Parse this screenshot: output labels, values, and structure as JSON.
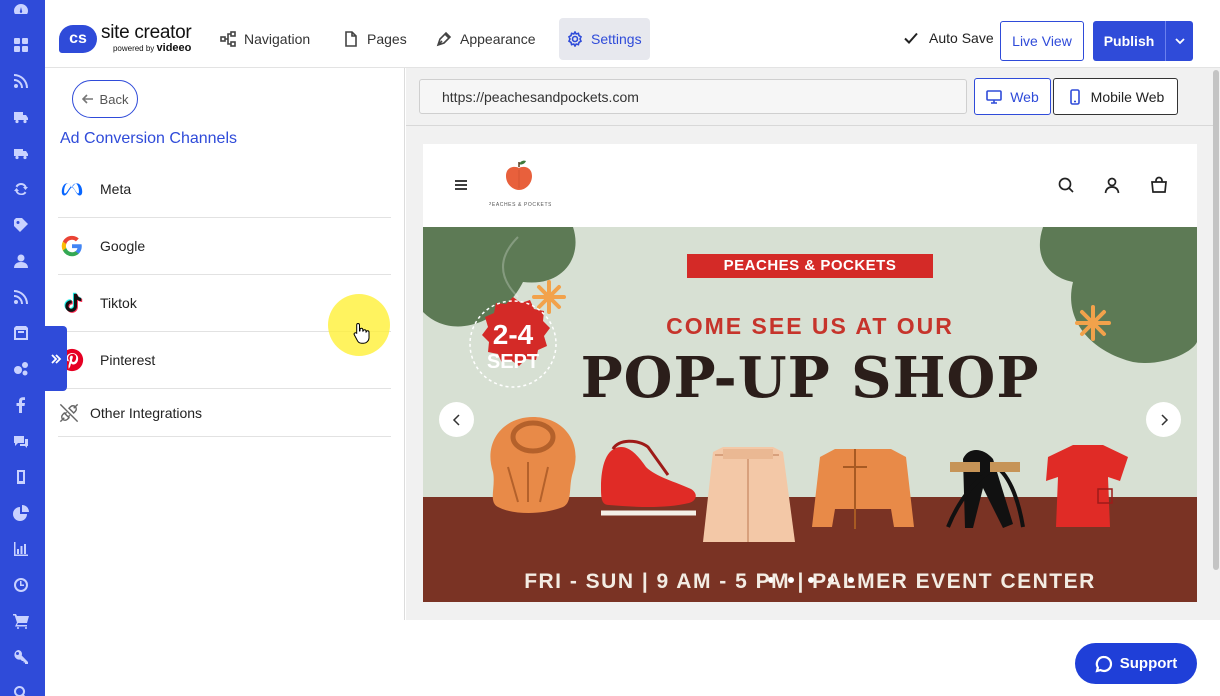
{
  "brand": {
    "badge": "cs",
    "name": "site creator",
    "powered_by": "powered by",
    "powered_brand": "videeo"
  },
  "nav": {
    "items": [
      {
        "label": "Navigation",
        "icon": "sitemap-icon"
      },
      {
        "label": "Pages",
        "icon": "page-icon"
      },
      {
        "label": "Appearance",
        "icon": "pen-icon"
      },
      {
        "label": "Settings",
        "icon": "gear-icon",
        "active": true
      }
    ]
  },
  "toolbar": {
    "autosave_label": "Auto Save",
    "live_view_label": "Live View",
    "publish_label": "Publish"
  },
  "panel": {
    "back_label": "Back",
    "title": "Ad Conversion Channels",
    "channels": [
      {
        "label": "Meta",
        "icon": "meta-icon"
      },
      {
        "label": "Google",
        "icon": "google-icon"
      },
      {
        "label": "Tiktok",
        "icon": "tiktok-icon"
      },
      {
        "label": "Pinterest",
        "icon": "pinterest-icon"
      },
      {
        "label": "Other Integrations",
        "icon": "plug-icon"
      }
    ]
  },
  "preview": {
    "url": "https://peachesandpockets.com",
    "web_label": "Web",
    "mobile_label": "Mobile Web"
  },
  "site": {
    "logo_text": "PEACHES & POCKETS",
    "hero": {
      "brand_banner": "PEACHES & POCKETS",
      "date_line1": "2-4",
      "date_line2": "SEPT",
      "headline_small": "COME SEE US AT OUR",
      "headline_big": "POP-UP SHOP",
      "footer": "FRI - SUN | 9 AM - 5 PM | PALMER EVENT CENTER"
    }
  },
  "support": {
    "label": "Support"
  },
  "colors": {
    "accent": "#2f4bd9",
    "rail": "#2f4bd9",
    "hero_bg": "#d7e0d3",
    "hero_ground": "#7a3324",
    "hero_red": "#d42a27",
    "hero_green": "#5d7a55"
  }
}
